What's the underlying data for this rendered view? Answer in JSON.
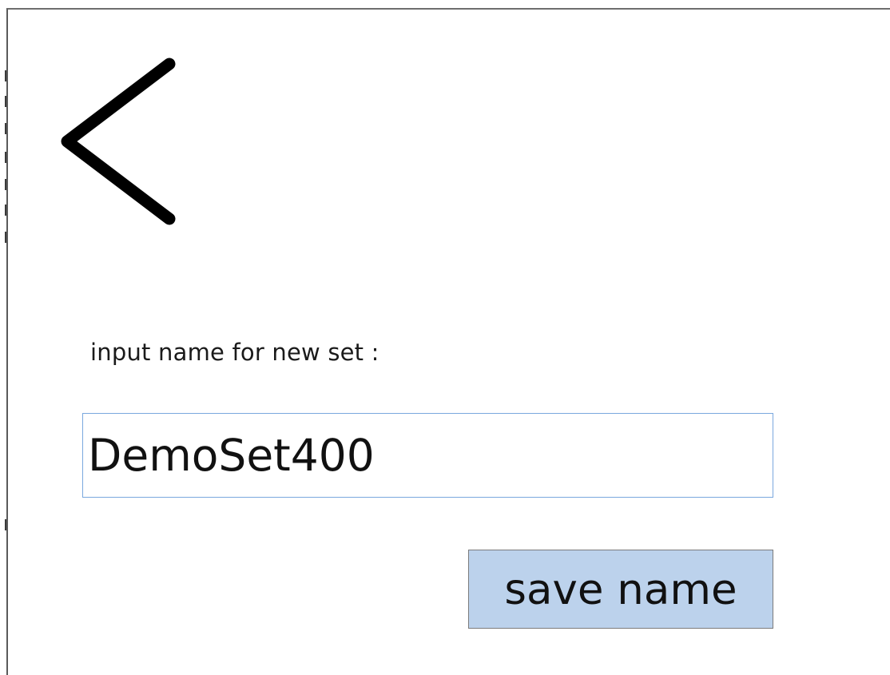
{
  "form": {
    "prompt_label": "input name for new set :",
    "name_value": "DemoSet400"
  },
  "actions": {
    "save_label": "save name"
  },
  "icons": {
    "back": "chevron-left-icon"
  },
  "colors": {
    "input_border": "#7aa8de",
    "save_button_bg": "#bcd2ec",
    "save_button_border": "#7c7c7c",
    "text": "#111111"
  }
}
